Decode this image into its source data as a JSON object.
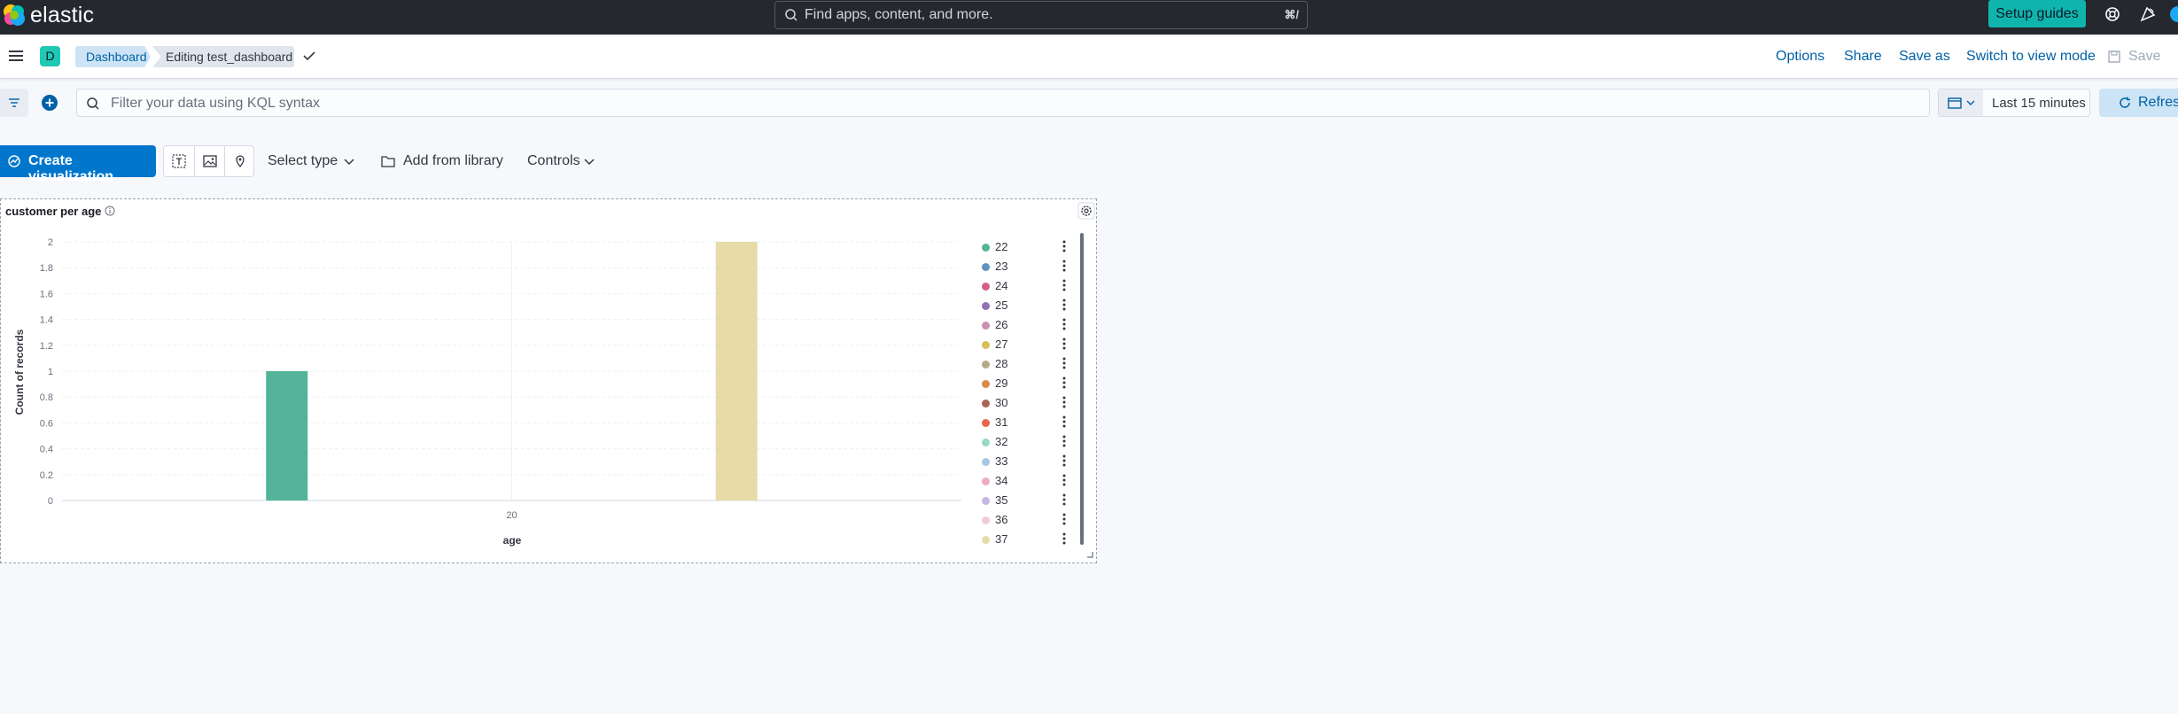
{
  "header": {
    "brand": "elastic",
    "search_placeholder": "Find apps, content, and more.",
    "search_shortcut": "⌘/",
    "setup_guides": "Setup guides"
  },
  "breadcrumbs": {
    "space_initial": "D",
    "items": [
      "Dashboard",
      "Editing test_dashboard"
    ]
  },
  "actions": {
    "options": "Options",
    "share": "Share",
    "save_as": "Save as",
    "switch_view": "Switch to view mode",
    "save": "Save"
  },
  "query": {
    "placeholder": "Filter your data using KQL syntax",
    "time_range": "Last 15 minutes",
    "refresh": "Refresh"
  },
  "toolbar": {
    "create_visualization": "Create visualization",
    "select_type": "Select type",
    "add_from_library": "Add from library",
    "controls": "Controls"
  },
  "panel": {
    "title": "customer per age"
  },
  "chart_data": {
    "type": "bar",
    "title": "customer per age",
    "xlabel": "age",
    "ylabel": "Count of records",
    "ylim": [
      0,
      2
    ],
    "yticks": [
      0,
      0.2,
      0.4,
      0.6,
      0.8,
      1,
      1.2,
      1.4,
      1.6,
      1.8,
      2
    ],
    "xticks": [
      20
    ],
    "grid": true,
    "legend_position": "right",
    "series": [
      {
        "name": "22",
        "x": 15,
        "value": 1,
        "color": "#54b399"
      },
      {
        "name": "37",
        "x": 25,
        "value": 2,
        "color": "#e7dba7"
      }
    ],
    "legend": [
      {
        "label": "22",
        "color": "#54b399"
      },
      {
        "label": "23",
        "color": "#6092c0"
      },
      {
        "label": "24",
        "color": "#d36086"
      },
      {
        "label": "25",
        "color": "#9170b8"
      },
      {
        "label": "26",
        "color": "#ca8eae"
      },
      {
        "label": "27",
        "color": "#d6bf57"
      },
      {
        "label": "28",
        "color": "#b9a888"
      },
      {
        "label": "29",
        "color": "#da8b45"
      },
      {
        "label": "30",
        "color": "#aa6556"
      },
      {
        "label": "31",
        "color": "#e7664c"
      },
      {
        "label": "32",
        "color": "#98d9c7"
      },
      {
        "label": "33",
        "color": "#a9c6e3"
      },
      {
        "label": "34",
        "color": "#f0a9c0"
      },
      {
        "label": "35",
        "color": "#c5b6e1"
      },
      {
        "label": "36",
        "color": "#f1c9dd"
      },
      {
        "label": "37",
        "color": "#e7dba7"
      }
    ]
  }
}
